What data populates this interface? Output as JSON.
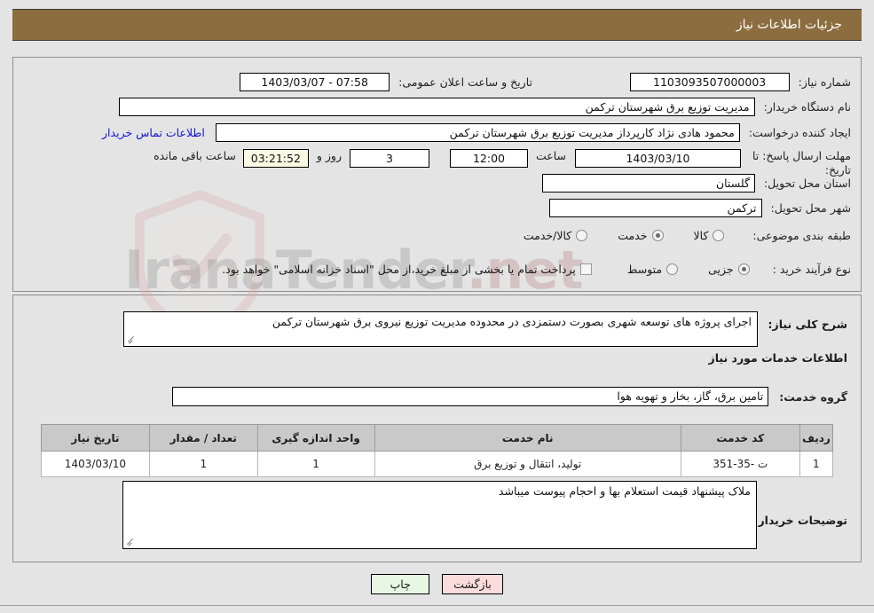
{
  "header": {
    "title": "جزئیات اطلاعات نیاز",
    "bg_color": "#8c6d3f"
  },
  "watermark": {
    "text_left": "Ir",
    "text_mid": "anaTender",
    "text_right": ".net"
  },
  "form": {
    "need_number": {
      "label": "شماره نیاز:",
      "value": "1103093507000003"
    },
    "announce_datetime": {
      "label": "تاریخ و ساعت اعلان عمومی:",
      "value": "1403/03/07 - 07:58"
    },
    "buyer_org": {
      "label": "نام دستگاه خریدار:",
      "value": "مدیریت توزیع برق شهرستان ترکمن"
    },
    "requester": {
      "label": "ایجاد کننده درخواست:",
      "value": "محمود  هادی نژاد کارپرداز مدیریت توزیع برق شهرستان ترکمن"
    },
    "contact_link": {
      "label": "اطلاعات تماس خریدار"
    },
    "deadline": {
      "label": "مهلت ارسال پاسخ: تا تاریخ:",
      "date": "1403/03/10",
      "hour_label": "ساعت",
      "hour": "12:00",
      "days": "3",
      "days_label": "روز و",
      "countdown": "03:21:52",
      "remaining_label": "ساعت باقی مانده"
    },
    "province": {
      "label": "استان محل تحویل:",
      "value": "گلستان"
    },
    "city": {
      "label": "شهر محل تحویل:",
      "value": "ترکمن"
    },
    "category": {
      "label": "طبقه بندی موضوعی:",
      "options": [
        {
          "label": "کالا",
          "selected": false
        },
        {
          "label": "خدمت",
          "selected": true
        },
        {
          "label": "کالا/خدمت",
          "selected": false
        }
      ]
    },
    "purchase_type": {
      "label": "نوع فرآیند خرید :",
      "options": [
        {
          "label": "جزیی",
          "selected": true
        },
        {
          "label": "متوسط",
          "selected": false
        }
      ],
      "checkbox_label": "پرداخت تمام یا بخشی از مبلغ خرید،از محل \"اسناد خزانه اسلامی\" خواهد بود.",
      "checkbox_checked": false
    }
  },
  "summary": {
    "label": "شرح کلی نیاز:",
    "value": "اجرای پروژه های توسعه شهری بصورت دستمزدی در محدوده مدیریت توزیع نیروی برق شهرستان ترکمن"
  },
  "services_section": {
    "heading": "اطلاعات خدمات مورد نیاز",
    "group_label": "گروه خدمت:",
    "group_value": "تامین برق، گاز، بخار و تهویه هوا"
  },
  "table": {
    "columns": [
      "ردیف",
      "کد خدمت",
      "نام خدمت",
      "واحد اندازه گیری",
      "تعداد / مقدار",
      "تاریخ نیاز"
    ],
    "rows": [
      {
        "radif": "1",
        "code": "ت -35-351",
        "name": "تولید، انتقال و توزیع برق",
        "unit": "1",
        "qty": "1",
        "date": "1403/03/10"
      }
    ]
  },
  "buyer_notes": {
    "label": "توضیحات خریدار:",
    "value": "ملاک پیشنهاد قیمت استعلام بها و احجام پیوست میباشد"
  },
  "buttons": {
    "print": {
      "label": "چاپ",
      "color": "#e8f7e4"
    },
    "back": {
      "label": "بازگشت",
      "color": "#fadcdc"
    }
  }
}
